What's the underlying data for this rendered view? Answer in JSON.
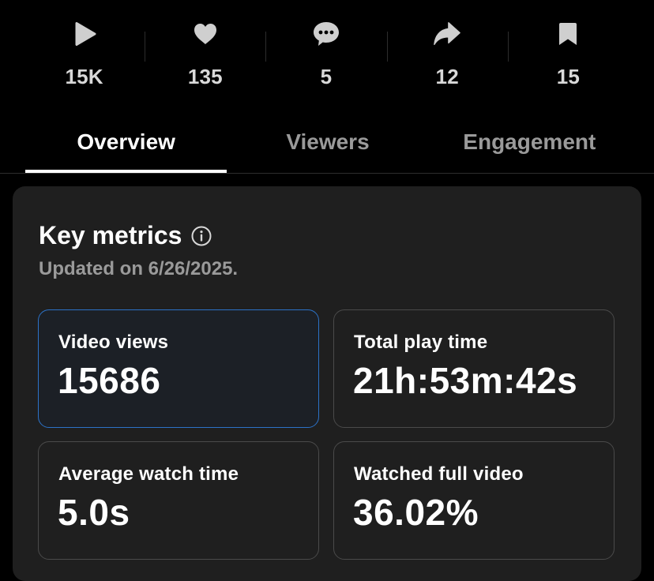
{
  "stats": [
    {
      "icon": "play-icon",
      "value": "15K"
    },
    {
      "icon": "heart-icon",
      "value": "135"
    },
    {
      "icon": "comment-icon",
      "value": "5"
    },
    {
      "icon": "share-icon",
      "value": "12"
    },
    {
      "icon": "bookmark-icon",
      "value": "15"
    }
  ],
  "tabs": [
    {
      "label": "Overview",
      "active": true
    },
    {
      "label": "Viewers",
      "active": false
    },
    {
      "label": "Engagement",
      "active": false
    }
  ],
  "key_metrics": {
    "title": "Key metrics",
    "info_icon": "info-icon",
    "updated": "Updated on 6/26/2025.",
    "items": [
      {
        "label": "Video views",
        "value": "15686",
        "selected": true
      },
      {
        "label": "Total play time",
        "value": "21h:53m:42s",
        "selected": false
      },
      {
        "label": "Average watch time",
        "value": "5.0s",
        "selected": false
      },
      {
        "label": "Watched full video",
        "value": "36.02%",
        "selected": false
      }
    ]
  },
  "colors": {
    "background": "#000000",
    "card": "#1f1f1f",
    "selected_border": "#2c72c7",
    "icon": "#cfcfcf",
    "muted_text": "#9a9a9a"
  }
}
